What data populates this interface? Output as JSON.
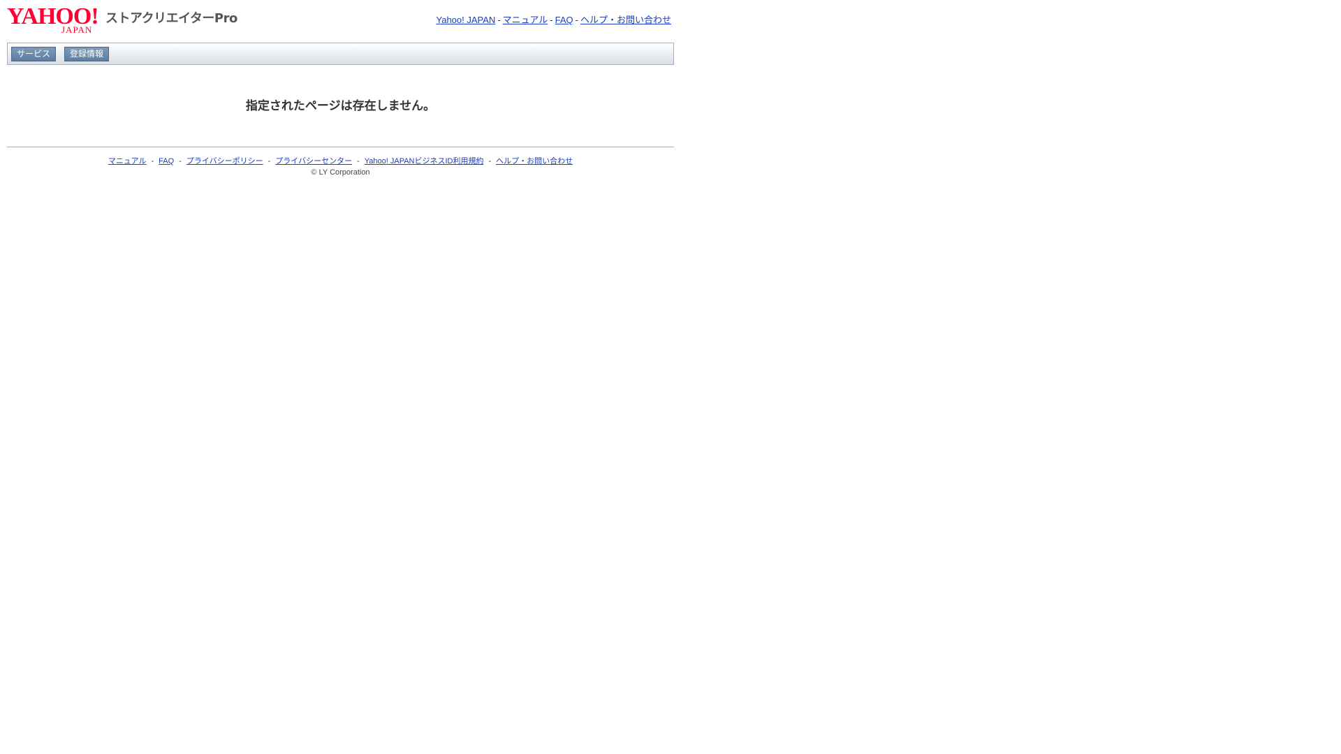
{
  "header": {
    "logo": {
      "brand": "YAHOO!",
      "brand_sub": "JAPAN",
      "product": "ストアクリエイターPro"
    },
    "links": [
      {
        "label": "Yahoo! JAPAN"
      },
      {
        "label": "マニュアル"
      },
      {
        "label": "FAQ"
      },
      {
        "label": "ヘルプ・お問い合わせ"
      }
    ],
    "separator": "-"
  },
  "nav": {
    "buttons": [
      {
        "label": "サービス"
      },
      {
        "label": "登録情報"
      }
    ]
  },
  "main": {
    "message": "指定されたページは存在しません。"
  },
  "footer": {
    "links": [
      {
        "label": "マニュアル"
      },
      {
        "label": "FAQ"
      },
      {
        "label": "プライバシーポリシー"
      },
      {
        "label": "プライバシーセンター"
      },
      {
        "label": "Yahoo! JAPANビジネスID利用規約"
      },
      {
        "label": "ヘルプ・お問い合わせ"
      }
    ],
    "separator": "-",
    "copyright": "© LY Corporation"
  },
  "colors": {
    "brand_red": "#ff0033",
    "link_blue": "#1a3dc1",
    "nav_button": "#5d7da0"
  }
}
